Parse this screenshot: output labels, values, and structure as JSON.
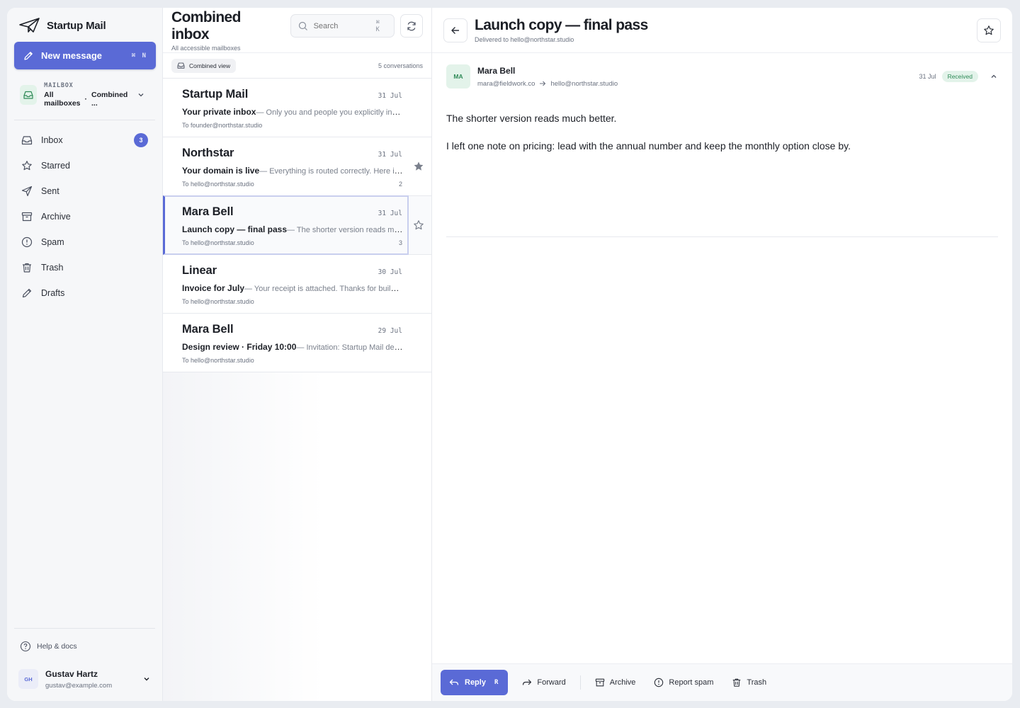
{
  "app": {
    "name": "Startup Mail",
    "accent": "#5a6ad6"
  },
  "sidebar": {
    "compose_label": "New message",
    "compose_shortcut": "⌘ N",
    "mailbox": {
      "caption": "MAILBOX",
      "name": "All mailboxes",
      "view": "Combined ..."
    },
    "items": [
      {
        "label": "Inbox",
        "icon": "inbox-icon",
        "badge": "3"
      },
      {
        "label": "Starred",
        "icon": "star-icon"
      },
      {
        "label": "Sent",
        "icon": "send-icon"
      },
      {
        "label": "Archive",
        "icon": "archive-icon"
      },
      {
        "label": "Spam",
        "icon": "alert-icon"
      },
      {
        "label": "Trash",
        "icon": "trash-icon"
      },
      {
        "label": "Drafts",
        "icon": "pencil-icon"
      }
    ],
    "help_label": "Help & docs",
    "user": {
      "initials": "GH",
      "name": "Gustav Hartz",
      "email": "gustav@example.com"
    }
  },
  "list": {
    "title": "Combined inbox",
    "subtitle": "All accessible mailboxes",
    "search_placeholder": "Search",
    "search_shortcut": "⌘ K",
    "view_chip": "Combined view",
    "count": "5 conversations",
    "rows": [
      {
        "sender": "Startup Mail",
        "date": "31 Jul",
        "subject": "Your private inbox",
        "snippet": "— Only you and people you explicitly invite can see this inbox.",
        "to": "To founder@northstar.studio",
        "count": "",
        "starred": false,
        "selected": false
      },
      {
        "sender": "Northstar",
        "date": "31 Jul",
        "subject": "Your domain is live",
        "snippet": "— Everything is routed correctly. Here is what happens next.",
        "to": "To hello@northstar.studio",
        "count": "2",
        "starred": true,
        "selected": false
      },
      {
        "sender": "Mara Bell",
        "date": "31 Jul",
        "subject": "Launch copy — final pass",
        "snippet": "— The shorter version reads much better.",
        "to": "To hello@northstar.studio",
        "count": "3",
        "starred": false,
        "selected": true
      },
      {
        "sender": "Linear",
        "date": "30 Jul",
        "subject": "Invoice for July",
        "snippet": "— Your receipt is attached. Thanks for building with us.",
        "to": "To hello@northstar.studio",
        "count": "",
        "starred": false,
        "selected": false
      },
      {
        "sender": "Mara Bell",
        "date": "29 Jul",
        "subject": "Design review · Friday 10:00",
        "snippet": "— Invitation: Startup Mail design review.",
        "to": "To hello@northstar.studio",
        "count": "",
        "starred": false,
        "selected": false
      }
    ]
  },
  "reader": {
    "title": "Launch copy — final pass",
    "subtitle": "Delivered to hello@northstar.studio",
    "message": {
      "initials": "MA",
      "from_name": "Mara Bell",
      "from_email": "mara@fieldwork.co",
      "to_email": "hello@northstar.studio",
      "date": "31 Jul",
      "status": "Received",
      "paragraphs": [
        "The shorter version reads much better.",
        "I left one note on pricing: lead with the annual number and keep the monthly option close by."
      ]
    },
    "actions": {
      "reply": "Reply",
      "reply_shortcut": "R",
      "forward": "Forward",
      "archive": "Archive",
      "report_spam": "Report spam",
      "trash": "Trash"
    }
  }
}
